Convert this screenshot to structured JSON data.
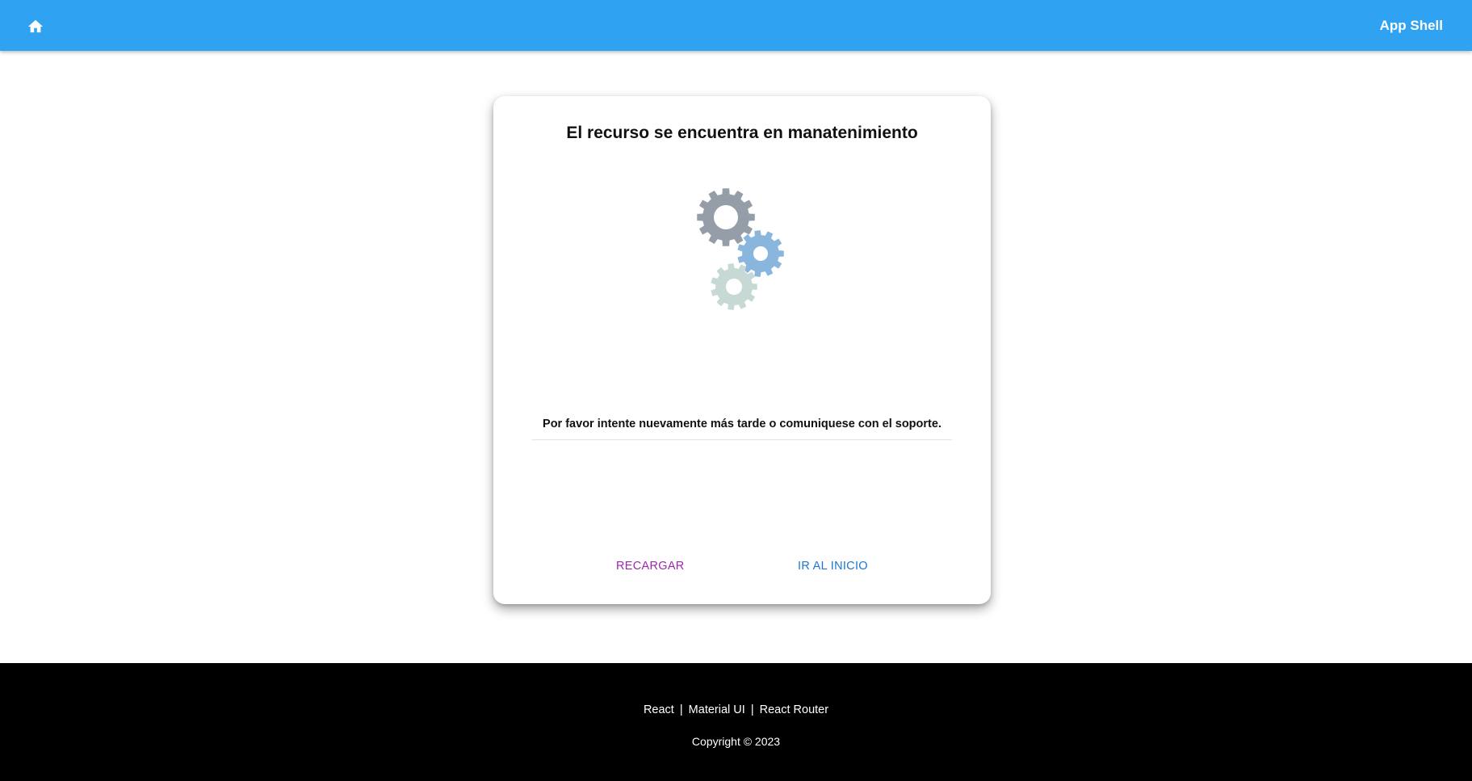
{
  "appbar": {
    "title": "App Shell",
    "home_icon": "home-icon",
    "background": "#2fa3f2"
  },
  "card": {
    "title": "El recurso se encuentra en manatenimiento",
    "illustration_icon": "gears-icon",
    "message": "Por favor intente nuevamente más tarde o comuniquese con el soporte.",
    "actions": {
      "reload_label": "RECARGAR",
      "home_label": "IR AL INICIO"
    },
    "colors": {
      "reload": "#9c27b0",
      "home": "#1976d2"
    }
  },
  "footer": {
    "links": [
      "React",
      "Material UI",
      "React Router"
    ],
    "separator": "|",
    "copyright": "Copyright © 2023"
  }
}
